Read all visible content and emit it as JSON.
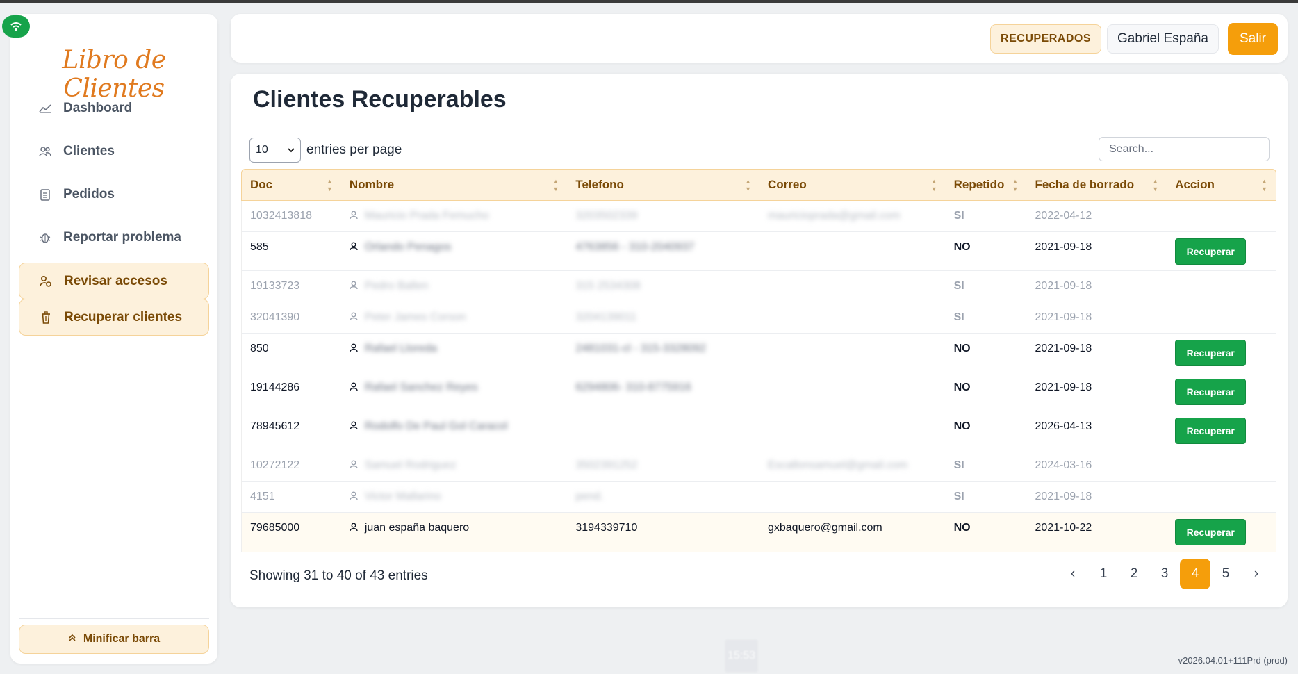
{
  "app": {
    "logo": "Libro de Clientes",
    "version": "v2026.04.01+111Prd (prod)",
    "clock": "15:53"
  },
  "sidebar": {
    "items": [
      {
        "label": "Dashboard",
        "icon": "chart-line-icon",
        "active": false
      },
      {
        "label": "Clientes",
        "icon": "users-icon",
        "active": false
      },
      {
        "label": "Pedidos",
        "icon": "clipboard-icon",
        "active": false
      },
      {
        "label": "Reportar problema",
        "icon": "bug-icon",
        "active": false
      },
      {
        "label": "Revisar accesos",
        "icon": "user-key-icon",
        "active": true
      },
      {
        "label": "Recuperar clientes",
        "icon": "trash-icon",
        "active": true
      }
    ],
    "minify_label": "Minificar barra"
  },
  "header": {
    "recuperados_label": "RECUPERADOS",
    "user_name": "Gabriel España",
    "logout_label": "Salir"
  },
  "main": {
    "title": "Clientes Recuperables",
    "entries_value": "10",
    "entries_label": "entries per page",
    "search_placeholder": "Search...",
    "columns": [
      "Doc",
      "Nombre",
      "Telefono",
      "Correo",
      "Repetido",
      "Fecha de borrado",
      "Accion"
    ],
    "rows": [
      {
        "doc": "1032413818",
        "nombre": "Mauricio Prada Femucho",
        "telefono": "3203502339",
        "correo": "mauricioprada@gmail.com",
        "repetido": "SI",
        "fecha": "2022-04-12",
        "accion": ""
      },
      {
        "doc": "585",
        "nombre": "Orlando Penagos",
        "telefono": "4763856 - 310-2040937",
        "correo": "",
        "repetido": "NO",
        "fecha": "2021-09-18",
        "accion": "Recuperar"
      },
      {
        "doc": "19133723",
        "nombre": "Pedro Ballen",
        "telefono": "315 2534308",
        "correo": "",
        "repetido": "SI",
        "fecha": "2021-09-18",
        "accion": ""
      },
      {
        "doc": "32041390",
        "nombre": "Peter James Corson",
        "telefono": "3204139011",
        "correo": "",
        "repetido": "SI",
        "fecha": "2021-09-18",
        "accion": ""
      },
      {
        "doc": "850",
        "nombre": "Rafael Lloreda",
        "telefono": "2481031-cl - 315-3328092",
        "correo": "",
        "repetido": "NO",
        "fecha": "2021-09-18",
        "accion": "Recuperar"
      },
      {
        "doc": "19144286",
        "nombre": "Rafael Sanchez Reyes",
        "telefono": "6294806- 310-8775916",
        "correo": "",
        "repetido": "NO",
        "fecha": "2021-09-18",
        "accion": "Recuperar"
      },
      {
        "doc": "78945612",
        "nombre": "Rodolfo De Paul Gol Caracol",
        "telefono": "",
        "correo": "",
        "repetido": "NO",
        "fecha": "2026-04-13",
        "accion": "Recuperar"
      },
      {
        "doc": "10272122",
        "nombre": "Samuel Rodriguez",
        "telefono": "3502391252",
        "correo": "Escallonsamuel@gmail.com",
        "repetido": "SI",
        "fecha": "2024-03-16",
        "accion": ""
      },
      {
        "doc": "4151",
        "nombre": "Victor Mallarino",
        "telefono": "pend.",
        "correo": "",
        "repetido": "SI",
        "fecha": "2021-09-18",
        "accion": ""
      },
      {
        "doc": "79685000",
        "nombre": "juan españa baquero",
        "telefono": "3194339710",
        "correo": "gxbaquero@gmail.com",
        "repetido": "NO",
        "fecha": "2021-10-22",
        "accion": "Recuperar"
      }
    ],
    "showing": "Showing 31 to 40 of 43 entries",
    "pagination": {
      "prev": "‹",
      "pages": [
        "1",
        "2",
        "3",
        "4",
        "5"
      ],
      "active": "4",
      "next": "›"
    }
  },
  "colors": {
    "accent": "#f59e0b",
    "accent_soft": "#fdf1dc",
    "success": "#16a34a",
    "logo": "#e07a1f"
  }
}
